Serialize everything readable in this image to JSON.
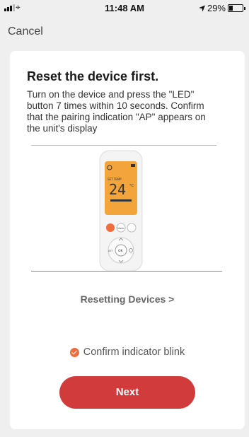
{
  "status_bar": {
    "time": "11:48 AM",
    "battery_percent": "29%",
    "battery_level": 0.29,
    "location_icon": "location-arrow-icon"
  },
  "nav": {
    "cancel_label": "Cancel"
  },
  "card": {
    "title": "Reset the device first.",
    "description": "Turn on the device and press the \"LED\" button 7 times within 10 seconds. Confirm that the pairing indication \"AP\" appears on the unit's display",
    "remote_display": {
      "label": "SET TEMP",
      "temperature": "24",
      "unit": "°C"
    },
    "remote_buttons": {
      "mode": "Mode",
      "set": "SET",
      "ok": "OK"
    },
    "reset_link": "Resetting Devices >",
    "confirm_label": "Confirm indicator blink",
    "next_label": "Next"
  },
  "colors": {
    "accent": "#d23b3b",
    "check": "#f06d3d",
    "display": "#f3a43a"
  }
}
